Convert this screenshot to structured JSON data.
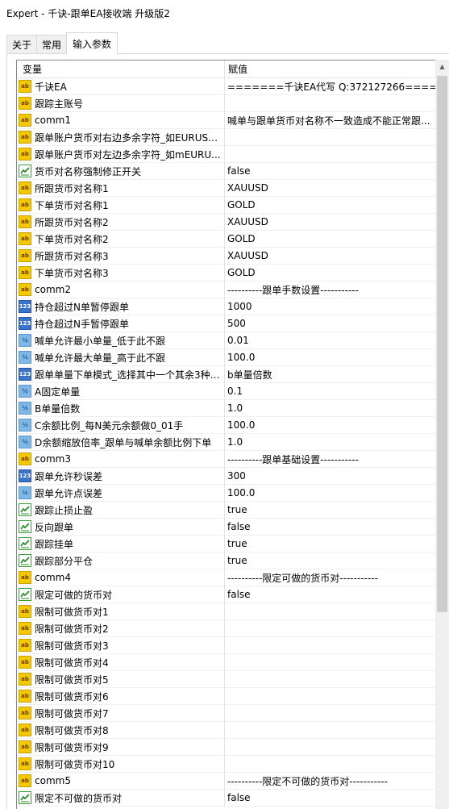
{
  "window": {
    "title": "Expert - 千诀-跟单EA接收端 升级版2"
  },
  "tabs": [
    {
      "label": "关于"
    },
    {
      "label": "常用"
    },
    {
      "label": "输入参数"
    }
  ],
  "grid": {
    "col_variable": "变量",
    "col_value": "赋值",
    "rows": [
      {
        "type": "str",
        "name": "千诀EA",
        "value": "=======千诀EA代写 Q:372127266====="
      },
      {
        "type": "str",
        "name": "跟踪主账号",
        "value": ""
      },
      {
        "type": "str",
        "name": "comm1",
        "value": "喊单与跟单货币对名称不一致造成不能正常跟..."
      },
      {
        "type": "str",
        "name": "跟单账户货币对右边多余字符_如EURUSD...",
        "value": ""
      },
      {
        "type": "str",
        "name": "跟单账户货币对左边多余字符_如mEURU...",
        "value": ""
      },
      {
        "type": "bool",
        "name": "货币对名称强制修正开关",
        "value": "false"
      },
      {
        "type": "str",
        "name": "所跟货币对名称1",
        "value": "XAUUSD"
      },
      {
        "type": "str",
        "name": "下单货币对名称1",
        "value": "GOLD"
      },
      {
        "type": "str",
        "name": "所跟货币对名称2",
        "value": "XAUUSD"
      },
      {
        "type": "str",
        "name": "下单货币对名称2",
        "value": "GOLD"
      },
      {
        "type": "str",
        "name": "所跟货币对名称3",
        "value": "XAUUSD"
      },
      {
        "type": "str",
        "name": "下单货币对名称3",
        "value": "GOLD"
      },
      {
        "type": "str",
        "name": "comm2",
        "value": "----------跟单手数设置-----------"
      },
      {
        "type": "int",
        "name": "持仓超过N单暂停跟单",
        "value": "1000"
      },
      {
        "type": "int",
        "name": "持仓超过N手暂停跟单",
        "value": "500"
      },
      {
        "type": "dbl",
        "name": "喊单允许最小单量_低于此不跟",
        "value": "0.01"
      },
      {
        "type": "dbl",
        "name": "喊单允许最大单量_高于此不跟",
        "value": "100.0"
      },
      {
        "type": "int",
        "name": "跟单单量下单模式_选择其中一个其余3种?...",
        "value": "b单量倍数"
      },
      {
        "type": "dbl",
        "name": "A固定单量",
        "value": "0.1"
      },
      {
        "type": "dbl",
        "name": "B单量倍数",
        "value": "1.0"
      },
      {
        "type": "dbl",
        "name": "C余额比例_每N美元余额做0_01手",
        "value": "100.0"
      },
      {
        "type": "dbl",
        "name": "D余额缩放倍率_跟单与喊单余额比例下单",
        "value": "1.0"
      },
      {
        "type": "str",
        "name": "comm3",
        "value": "----------跟单基础设置-----------"
      },
      {
        "type": "int",
        "name": "跟单允许秒误差",
        "value": "300"
      },
      {
        "type": "dbl",
        "name": "跟单允许点误差",
        "value": "100.0"
      },
      {
        "type": "bool",
        "name": "跟踪止损止盈",
        "value": "true"
      },
      {
        "type": "bool",
        "name": "反向跟单",
        "value": "false"
      },
      {
        "type": "bool",
        "name": "跟踪挂单",
        "value": "true"
      },
      {
        "type": "bool",
        "name": "跟踪部分平仓",
        "value": "true"
      },
      {
        "type": "str",
        "name": "comm4",
        "value": "----------限定可做的货币对-----------"
      },
      {
        "type": "bool",
        "name": "限定可做的货币对",
        "value": "false"
      },
      {
        "type": "str",
        "name": "限制可做货币对1",
        "value": ""
      },
      {
        "type": "str",
        "name": "限制可做货币对2",
        "value": ""
      },
      {
        "type": "str",
        "name": "限制可做货币对3",
        "value": ""
      },
      {
        "type": "str",
        "name": "限制可做货币对4",
        "value": ""
      },
      {
        "type": "str",
        "name": "限制可做货币对5",
        "value": ""
      },
      {
        "type": "str",
        "name": "限制可做货币对6",
        "value": ""
      },
      {
        "type": "str",
        "name": "限制可做货币对7",
        "value": ""
      },
      {
        "type": "str",
        "name": "限制可做货币对8",
        "value": ""
      },
      {
        "type": "str",
        "name": "限制可做货币对9",
        "value": ""
      },
      {
        "type": "str",
        "name": "限制可做货币对10",
        "value": ""
      },
      {
        "type": "str",
        "name": "comm5",
        "value": "----------限定不可做的货币对-----------"
      },
      {
        "type": "bool",
        "name": "限定不可做的货币对",
        "value": "false"
      }
    ]
  },
  "icons": {
    "str": "ab",
    "int": "123",
    "dbl": "½",
    "bool": "toggle-icon"
  },
  "colors": {
    "str_icon": "#f6c800",
    "int_icon": "#3b73c9",
    "dbl_icon": "#7fb8e8",
    "bool_icon": "#3a9b3a"
  }
}
